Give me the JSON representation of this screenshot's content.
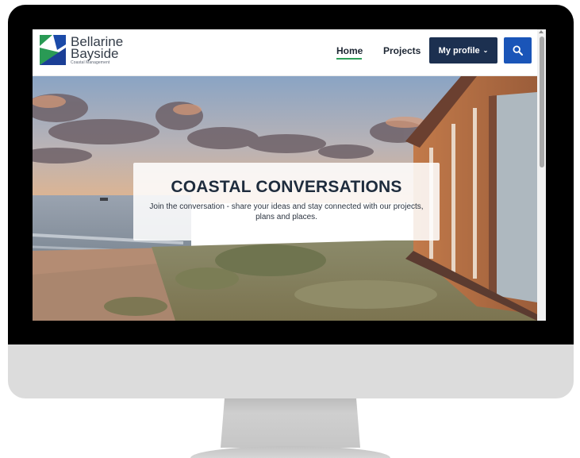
{
  "site": {
    "brand_line1": "Bellarine",
    "brand_line2": "Bayside",
    "brand_tagline": "Coastal Management",
    "colors": {
      "navy": "#1c3050",
      "blue": "#1a55b8",
      "green": "#2e9f5a"
    }
  },
  "nav": {
    "home": "Home",
    "projects": "Projects",
    "profile": "My profile",
    "profile_chevron": "⌄",
    "search_icon": "search-icon"
  },
  "hero": {
    "title": "COASTAL CONVERSATIONS",
    "subtitle": "Join the conversation - share your ideas and stay connected with our projects, plans and places."
  }
}
